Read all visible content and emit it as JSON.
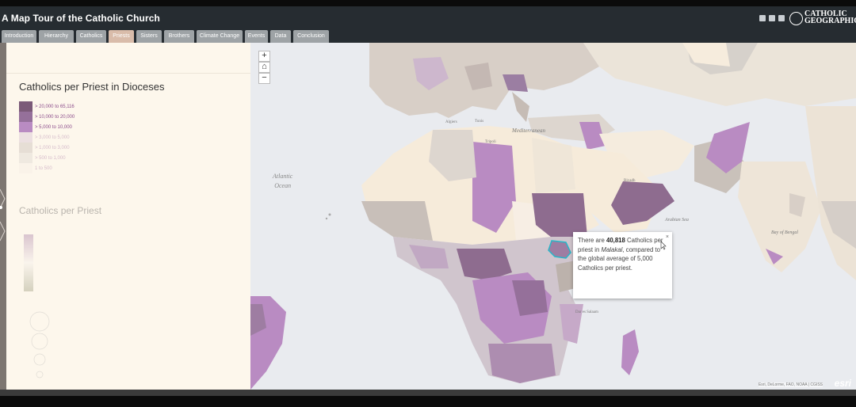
{
  "app": {
    "title": "A Map Tour of the Catholic Church"
  },
  "header": {
    "social_icons": [
      "facebook-icon",
      "twitter-icon",
      "link-icon"
    ],
    "logo_line1": "CATHOLIC",
    "logo_line2": "GEOGRAPHIC"
  },
  "tabs": [
    {
      "label": "Introduction",
      "active": false
    },
    {
      "label": "Hierarchy",
      "active": false
    },
    {
      "label": "Catholics",
      "active": false
    },
    {
      "label": "Priests",
      "active": true
    },
    {
      "label": "Sisters",
      "active": false
    },
    {
      "label": "Brothers",
      "active": false
    },
    {
      "label": "Climate Change",
      "active": false
    },
    {
      "label": "Events",
      "active": false
    },
    {
      "label": "Data",
      "active": false
    },
    {
      "label": "Conclusion",
      "active": false
    }
  ],
  "sidebar": {
    "legend_title": "Catholics per Priest in Dioceses",
    "legend": [
      {
        "label": "> 20,000 to 65,116",
        "color": "#7b5a78"
      },
      {
        "label": "> 10,000 to 20,000",
        "color": "#95709a"
      },
      {
        "label": "> 5,000 to 10,000",
        "color": "#b98bc2"
      },
      {
        "label": "> 3,000 to 5,000",
        "color": "#cdb7cd"
      },
      {
        "label": "> 1,000 to 3,000",
        "color": "#bcb2ac"
      },
      {
        "label": "> 500 to 1,000",
        "color": "#d6d1cb"
      },
      {
        "label": "1 to 500",
        "color": "#f7eee4"
      }
    ],
    "faded_title": "Catholics per Priest"
  },
  "map": {
    "zoom_in": "+",
    "home": "⌂",
    "zoom_out": "−",
    "places": {
      "algiers": "Algiers",
      "tunis": "Tunis",
      "mediterranean": "Mediterranean",
      "tripoli": "Tripoli",
      "riyadh": "Riyadh",
      "arabian_sea": "Arabian Sea",
      "bay_of_bengal": "Bay of Bengal",
      "dar_es_salaam": "Dar es Salaam"
    },
    "ocean_line1": "Atlantic",
    "ocean_line2": "Ocean",
    "attribution": "Esri, DeLorme, FAO, NOAA | CGISS",
    "esri": "esri"
  },
  "popup": {
    "pre": "There are ",
    "value": "40,818",
    "mid": " Catholics per priest in ",
    "place": "Malakal",
    "post": ", compared to the global average of 5,000 Catholics per priest.",
    "close": "×"
  }
}
